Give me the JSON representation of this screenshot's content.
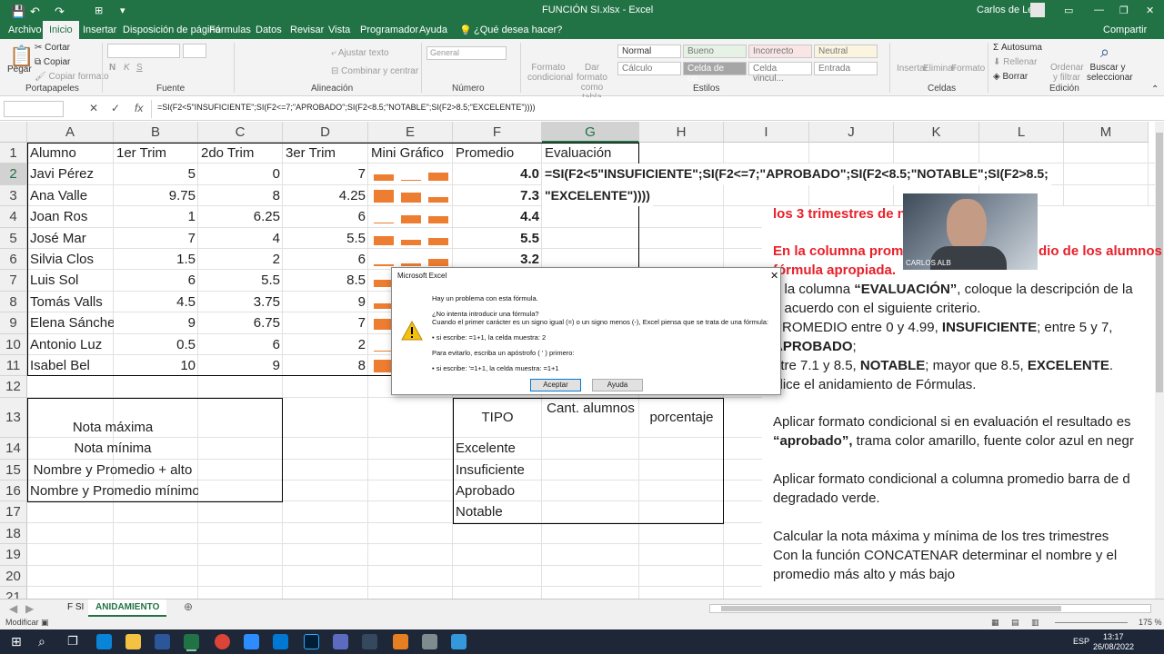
{
  "window": {
    "title": "FUNCIÓN SI.xlsx  -  Excel",
    "user": "Carlos de Leon",
    "share": "Compartir"
  },
  "ribbon_tabs": [
    "Archivo",
    "Inicio",
    "Insertar",
    "Disposición de página",
    "Fórmulas",
    "Datos",
    "Revisar",
    "Vista",
    "Programador",
    "Ayuda",
    "¿Qué desea hacer?"
  ],
  "ribbon": {
    "cortar": "Cortar",
    "copiar": "Copiar",
    "pegar": "Pegar",
    "copiar_formato": "Copiar formato",
    "portapapeles": "Portapapeles",
    "fuente": "Fuente",
    "alineacion": "Alineación",
    "numero": "Número",
    "estilos": "Estilos",
    "celdas": "Celdas",
    "edicion": "Edición",
    "ajustar_texto": "Ajustar texto",
    "combinar": "Combinar y centrar",
    "general": "General",
    "formato_condicional": "Formato condicional",
    "dar_formato": "Dar formato como tabla",
    "styles": [
      "Normal",
      "Bueno",
      "Incorrecto",
      "Neutral",
      "Cálculo",
      "Celda de co...",
      "Celda vincul...",
      "Entrada"
    ],
    "insertar": "Insertar",
    "eliminar": "Eliminar",
    "formato": "Formato",
    "autosuma": "Autosuma",
    "rellenar": "Rellenar",
    "borrar": "Borrar",
    "ordenar": "Ordenar y filtrar",
    "buscar": "Buscar y seleccionar"
  },
  "formula_bar": {
    "fx": "fx",
    "formula": "=SI(F2<5\"INSUFICIENTE\";SI(F2<=7;\"APROBADO\";SI(F2<8.5;\"NOTABLE\";SI(F2>8.5;\"EXCELENTE\"))))"
  },
  "columns": [
    "A",
    "B",
    "C",
    "D",
    "E",
    "F",
    "G",
    "H",
    "I",
    "J",
    "K",
    "L",
    "M"
  ],
  "rows": [
    "1",
    "2",
    "3",
    "4",
    "5",
    "6",
    "7",
    "8",
    "9",
    "10",
    "11",
    "12",
    "13",
    "14",
    "15",
    "16",
    "17",
    "18",
    "19",
    "20",
    "21"
  ],
  "headers": [
    "Alumno",
    "1er Trim",
    "2do Trim",
    "3er Trim",
    "Mini Gráfico",
    "Promedio",
    "Evaluación"
  ],
  "students": [
    {
      "name": "Javi Pérez",
      "t1": "5",
      "t2": "0",
      "t3": "7",
      "avg": "4.0",
      "spark": [
        5,
        0,
        7
      ]
    },
    {
      "name": "Ana Valle",
      "t1": "9.75",
      "t2": "8",
      "t3": "4.25",
      "avg": "7.3",
      "spark": [
        9.75,
        8,
        4.25
      ]
    },
    {
      "name": "Joan Ros",
      "t1": "1",
      "t2": "6.25",
      "t3": "6",
      "avg": "4.4",
      "spark": [
        1,
        6.25,
        6
      ]
    },
    {
      "name": "José Mar",
      "t1": "7",
      "t2": "4",
      "t3": "5.5",
      "avg": "5.5",
      "spark": [
        7,
        4,
        5.5
      ]
    },
    {
      "name": "Silvia Clos",
      "t1": "1.5",
      "t2": "2",
      "t3": "6",
      "avg": "3.2",
      "spark": [
        1.5,
        2,
        6
      ]
    },
    {
      "name": "Luis Sol",
      "t1": "6",
      "t2": "5.5",
      "t3": "8.5",
      "avg": "",
      "spark": [
        6,
        5.5,
        8.5
      ]
    },
    {
      "name": "Tomás Valls",
      "t1": "4.5",
      "t2": "3.75",
      "t3": "9",
      "avg": "",
      "spark": [
        4.5,
        3.75,
        9
      ]
    },
    {
      "name": "Elena Sánchez",
      "t1": "9",
      "t2": "6.75",
      "t3": "7",
      "avg": "",
      "spark": [
        9,
        6.75,
        7
      ]
    },
    {
      "name": "Antonio Luz",
      "t1": "0.5",
      "t2": "6",
      "t3": "2",
      "avg": "",
      "spark": [
        0.5,
        6,
        2
      ]
    },
    {
      "name": "Isabel Bel",
      "t1": "10",
      "t2": "9",
      "t3": "8",
      "avg": "",
      "spark": [
        10,
        9,
        8
      ]
    }
  ],
  "g2_formula_line1": "=SI(F2<5\"INSUFICIENTE\";SI(F2<=7;\"APROBADO\";SI(F2<8.5;\"NOTABLE\";SI(F2>8.5;",
  "g2_formula_line2": "\"EXCELENTE\"))))",
  "summary": [
    "Nota máxima",
    "Nota mínima",
    "Nombre y Promedio + alto",
    "Nombre y Promedio mínimo"
  ],
  "tipo": {
    "header": "TIPO",
    "cant": "Cant. alumnos",
    "pct": "porcentaje",
    "items": [
      "Excelente",
      "Insuficiente",
      "Aprobado",
      "Notable"
    ]
  },
  "notes": {
    "n1": "los 3 trimestres de n",
    "n2": "En la columna prom",
    "n2b": "dio de los alumnos",
    "n3": "fórmula apropiada.",
    "n4a": "n la columna ",
    "n4b": "“EVALUACIÓN”",
    "n4c": ", coloque la descripción de la",
    "n5": "e acuerdo con el siguiente criterio.",
    "n6a": "PROMEDIO entre 0 y 4.99, ",
    "n6b": "INSUFICIENTE",
    "n6c": "; entre 5 y 7,",
    "n7": "APROBADO",
    "n7b": ";",
    "n8a": "ntre 7.1 y 8.5, ",
    "n8b": "NOTABLE",
    "n8c": "; mayor que 8.5, ",
    "n8d": "EXCELENTE",
    "n8e": ".",
    "n9": "tilice el anidamiento de Fórmulas.",
    "n10": "Aplicar formato condicional si en evaluación el resultado es",
    "n11a": "“aprobado”,",
    "n11b": " trama color amarillo, fuente color azul en negr",
    "n12": "Aplicar formato condicional a columna promedio barra de d",
    "n13": "degradado verde.",
    "n14": "Calcular la nota máxima y mínima de los tres trimestres",
    "n15": "Con la función CONCATENAR determinar el nombre y el",
    "n16": "promedio más alto y más bajo"
  },
  "webcam_label": "CARLOS ALB",
  "dialog": {
    "title": "Microsoft Excel",
    "l1": "Hay un problema con esta fórmula.",
    "l2": "¿No intenta introducir una fórmula?",
    "l3": "Cuando el primer carácter es un signo igual (=) o un signo menos (-), Excel piensa que se trata de una fórmula:",
    "l4": "• si escribe:   =1+1, la celda muestra:   2",
    "l5": "Para evitarlo, escriba un apóstrofo ( ' ) primero:",
    "l6": "• si escribe:   '=1+1, la celda muestra:  =1+1",
    "ok": "Aceptar",
    "help": "Ayuda"
  },
  "sheet_tabs": [
    "F SI",
    "ANIDAMIENTO"
  ],
  "status": {
    "mode": "Modificar",
    "zoom": "175 %"
  },
  "clock": {
    "time": "13:17",
    "date": "26/08/2022",
    "lang": "ESP"
  },
  "colors": {
    "excel_green": "#217346",
    "spark": "#ed7d31",
    "red_text": "#e8202a"
  }
}
